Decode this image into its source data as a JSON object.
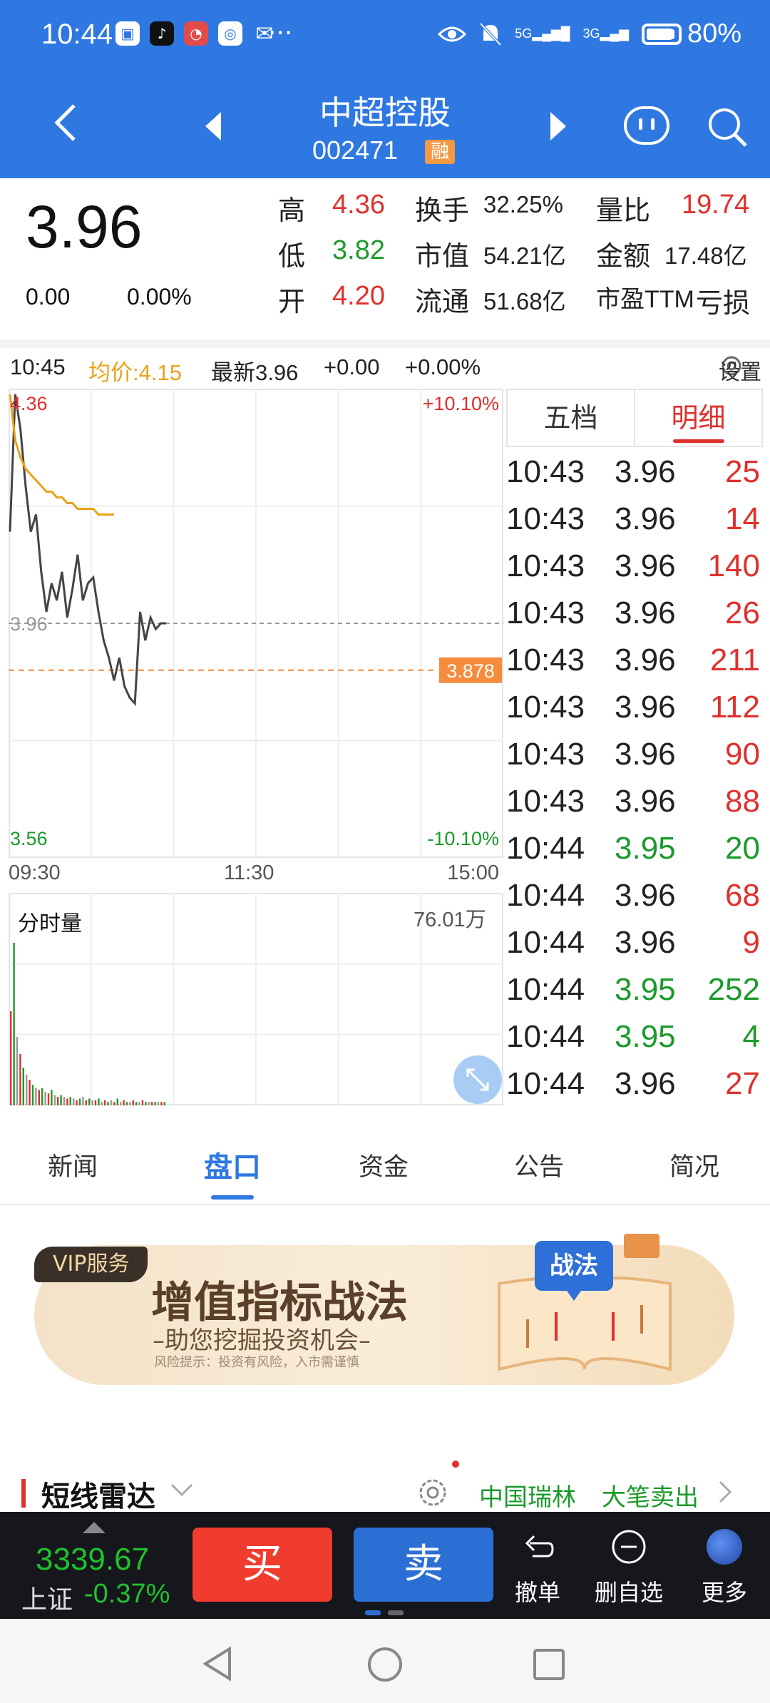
{
  "status_bar": {
    "time": "10:44",
    "dots": "···",
    "battery_pct": "80%",
    "net1": "5G",
    "net2": "3G"
  },
  "header": {
    "stock_name": "中超控股",
    "stock_code": "002471",
    "margin_badge": "融"
  },
  "quote": {
    "price": "3.96",
    "change": "0.00",
    "change_pct": "0.00%",
    "high_label": "高",
    "high": "4.36",
    "low_label": "低",
    "low": "3.82",
    "open_label": "开",
    "open": "4.20",
    "turnover_label": "换手",
    "turnover": "32.25%",
    "mktcap_label": "市值",
    "mktcap": "54.21亿",
    "float_label": "流通",
    "float": "51.68亿",
    "vol_ratio_label": "量比",
    "vol_ratio": "19.74",
    "amount_label": "金额",
    "amount": "17.48亿",
    "pe_label": "市盈TTM",
    "pe": "亏损"
  },
  "chart_info": {
    "time": "10:45",
    "avg": "均价:4.15",
    "latest": "最新3.96",
    "chg": "+0.00",
    "pct": "+0.00%",
    "settings": "设置"
  },
  "chart": {
    "y_top": "4.36",
    "y_mid": "3.96",
    "y_bottom": "3.56",
    "pct_top": "+10.10%",
    "pct_bottom": "-10.10%",
    "avg_marker": "3.878",
    "time_start": "09:30",
    "time_mid": "11:30",
    "time_end": "15:00",
    "volume_label": "分时量",
    "volume_max": "76.01万"
  },
  "chart_data": {
    "type": "line",
    "ylim": [
      3.56,
      4.36
    ],
    "prev_close": 3.96,
    "avg_line_value": 3.878,
    "series": [
      {
        "values": [
          4.12,
          4.36,
          4.3,
          4.2,
          4.12,
          4.15,
          4.05,
          3.98,
          4.03,
          4.0,
          4.05,
          3.97,
          4.02,
          4.08,
          4.0,
          4.03,
          4.04,
          3.98,
          3.93,
          3.9,
          3.86,
          3.9,
          3.85,
          3.83,
          3.82,
          3.98,
          3.93,
          3.97,
          3.95,
          3.96,
          3.96
        ]
      },
      {
        "values": [
          4.36,
          4.28,
          4.25,
          4.23,
          4.22,
          4.21,
          4.2,
          4.19,
          4.19,
          4.18,
          4.18,
          4.17,
          4.17,
          4.16,
          4.16,
          4.16,
          4.16,
          4.15,
          4.15,
          4.15,
          4.15
        ]
      }
    ]
  },
  "ticks": {
    "tab_five": "五档",
    "tab_detail": "明细",
    "rows": [
      {
        "time": "10:43",
        "price": "3.96",
        "vol": "25",
        "dir": "up"
      },
      {
        "time": "10:43",
        "price": "3.96",
        "vol": "14",
        "dir": "up"
      },
      {
        "time": "10:43",
        "price": "3.96",
        "vol": "140",
        "dir": "up"
      },
      {
        "time": "10:43",
        "price": "3.96",
        "vol": "26",
        "dir": "up"
      },
      {
        "time": "10:43",
        "price": "3.96",
        "vol": "211",
        "dir": "up"
      },
      {
        "time": "10:43",
        "price": "3.96",
        "vol": "112",
        "dir": "up"
      },
      {
        "time": "10:43",
        "price": "3.96",
        "vol": "90",
        "dir": "up"
      },
      {
        "time": "10:43",
        "price": "3.96",
        "vol": "88",
        "dir": "up"
      },
      {
        "time": "10:44",
        "price": "3.95",
        "vol": "20",
        "dir": "down"
      },
      {
        "time": "10:44",
        "price": "3.96",
        "vol": "68",
        "dir": "up"
      },
      {
        "time": "10:44",
        "price": "3.96",
        "vol": "9",
        "dir": "up"
      },
      {
        "time": "10:44",
        "price": "3.95",
        "vol": "252",
        "dir": "down"
      },
      {
        "time": "10:44",
        "price": "3.95",
        "vol": "4",
        "dir": "down"
      },
      {
        "time": "10:44",
        "price": "3.96",
        "vol": "27",
        "dir": "up"
      }
    ]
  },
  "sections": {
    "news": "新闻",
    "quote": "盘口",
    "funds": "资金",
    "notice": "公告",
    "profile": "简况"
  },
  "banner": {
    "vip": "VIP服务",
    "title": "增值指标战法",
    "subtitle": "–助您挖掘投资机会–",
    "note": "风险提示：投资有风险，入市需谨慎",
    "book_label": "战法"
  },
  "radar": {
    "title": "短线雷达",
    "stock": "中国瑞林",
    "action": "大笔卖出"
  },
  "tradebar": {
    "index_value": "3339.67",
    "index_name": "上证",
    "index_pct": "-0.37%",
    "buy": "买",
    "sell": "卖",
    "cancel": "撤单",
    "remove_watch": "删自选",
    "more": "更多"
  },
  "colors": {
    "header_blue": "#2f78e2",
    "up_red": "#e0302c",
    "down_green": "#1a9a2a",
    "avg_orange": "#e8a317"
  }
}
